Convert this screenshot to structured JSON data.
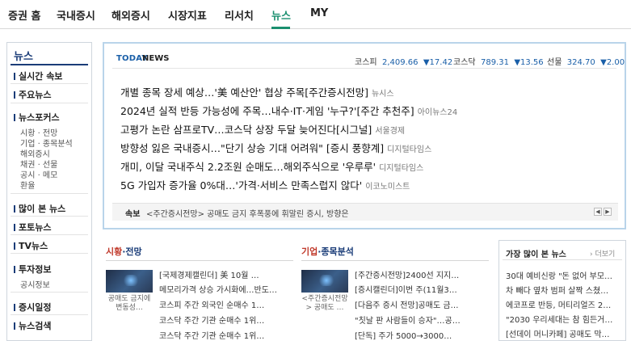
{
  "nav": {
    "items": [
      "증권 홈",
      "국내증시",
      "해외증시",
      "시장지표",
      "리서치",
      "뉴스",
      "MY"
    ],
    "active": "뉴스"
  },
  "sidebar": {
    "title": "뉴스",
    "sections": [
      {
        "label": "실시간 속보"
      },
      {
        "label": "주요뉴스"
      },
      {
        "label": "뉴스포커스",
        "subs": [
          "시황 · 전망",
          "기업 · 종목분석",
          "해외증시",
          "채권 · 선물",
          "공시 · 메모",
          "환율"
        ]
      },
      {
        "label": "많이 본 뉴스"
      },
      {
        "label": "포토뉴스"
      },
      {
        "label": "TV뉴스"
      },
      {
        "label": "투자정보",
        "subs": [
          "공시정보"
        ]
      },
      {
        "label": "증시일정"
      },
      {
        "label": "뉴스검색"
      }
    ]
  },
  "today": {
    "label_today": "TODAY",
    "label_news": "NEWS",
    "indices": [
      {
        "name": "코스피",
        "value": "2,409.66",
        "change": "▼17.42"
      },
      {
        "name": "코스닥",
        "value": "789.31",
        "change": "▼13.56"
      },
      {
        "name": "선물",
        "value": "324.70",
        "change": "▼2.00"
      }
    ],
    "headlines": [
      {
        "title": "개별 종목 장세 예상…'美 예산안' 협상 주목[주간증시전망]",
        "source": "뉴시스"
      },
      {
        "title": "2024년 실적 반등 가능성에 주목…내수·IT·게임 '누구?'[주간 추천주]",
        "source": "아이뉴스24"
      },
      {
        "title": "고평가 논란 삼프로TV…코스닥 상장 두달 늦어진다[시그널]",
        "source": "서울경제"
      },
      {
        "title": "방향성 잃은 국내증시…\"단기 상승 기대 어려워\" [증시 풍향계]",
        "source": "디지털타임스"
      },
      {
        "title": "개미, 이달 국내주식 2.2조원 순매도…해외주식으로 '우루루'",
        "source": "디지털타임스"
      },
      {
        "title": "5G 가입자 증가율 0%대…'가격·서비스 만족스럽지 않다'",
        "source": "이코노미스트"
      }
    ],
    "ticker_label": "속보",
    "ticker_text": "<주간증시전망> 공매도 금지 후폭풍에 휘말린 증시, 방향은",
    "prev_icon": "chevron-left-icon",
    "next_icon": "chevron-right-icon"
  },
  "market": {
    "title_red": "시황",
    "title_rest": "·전망",
    "thumb_caption": "공매도 금지에 변동성…",
    "items": [
      "[국제경제캘린더] 美 10월 …",
      "메모리가격 상승 가시화에…반도…",
      "코스피 주간 외국인 순매수 1…",
      "코스닥 주간 기관 순매수 1위…",
      "코스닥 주간 기관 순매수 1위…"
    ]
  },
  "company": {
    "title_red": "기업",
    "title_rest": "·종목분석",
    "thumb_caption": "<주간증시전망> 공매도 …",
    "items": [
      "[주간증시전망]2400선 지지…",
      "[증시캘린더]이번 주(11월3…",
      "[다음주 증시 전망]공매도 금…",
      "\"칫날 판 사람들이 승자\"…공…",
      "[단독] 주가 5000→3000…"
    ]
  },
  "popular": {
    "title": "가장 많이 본 뉴스",
    "more": "› 더보기",
    "items": [
      "30대 예비신랑 \"돈 없어 부모…",
      "차 빼다 옆차 범퍼 살짝 스쳤…",
      "에코프로 반등, 머티리얼즈 2…",
      "\"2030 우리세대는 참 힘든거…",
      "[선데이 머니카페] 공매도 막…"
    ]
  }
}
